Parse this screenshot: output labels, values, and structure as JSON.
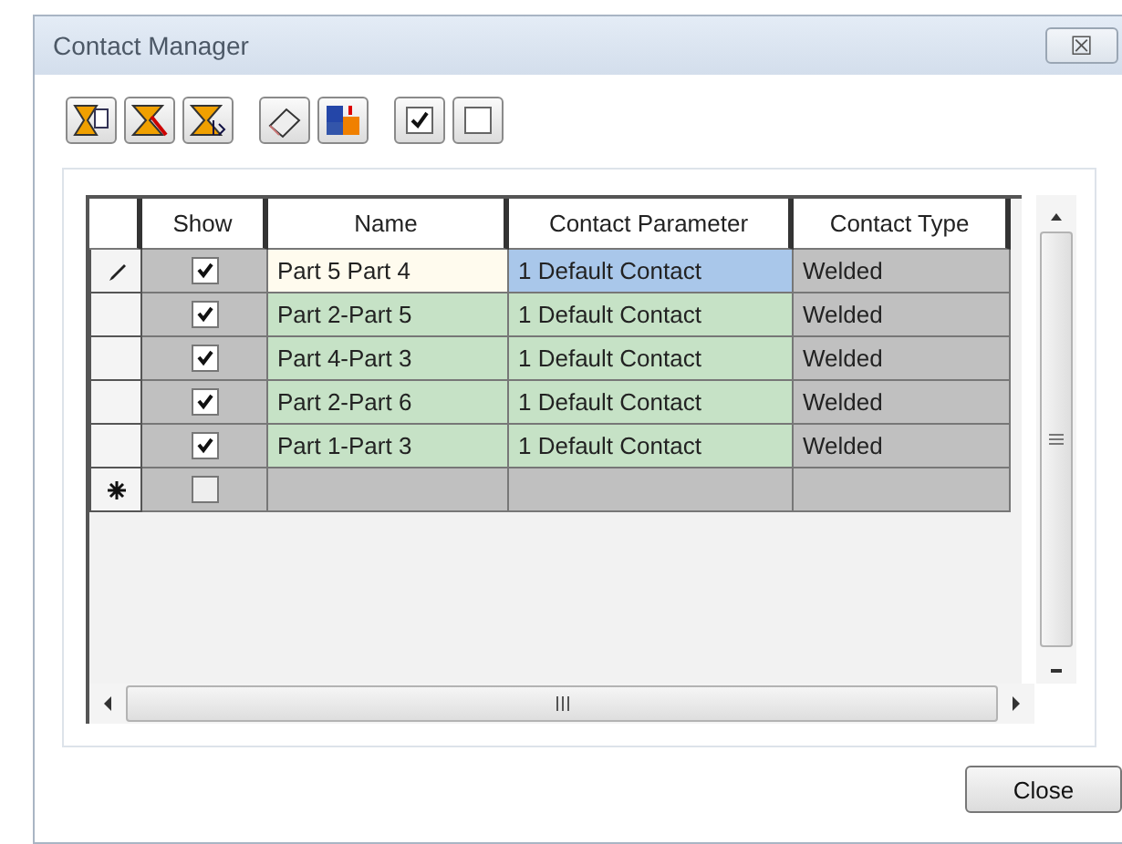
{
  "window": {
    "title": "Contact Manager",
    "close_glyph": "☒"
  },
  "table": {
    "columns": [
      "Show",
      "Name",
      "Contact Parameter",
      "Contact Type"
    ],
    "rows": [
      {
        "kind": "edit",
        "show": true,
        "selected": true,
        "name": "Part 5 Part 4",
        "parameter": "1 Default Contact",
        "type": "Welded"
      },
      {
        "kind": "plain",
        "show": true,
        "selected": false,
        "name": "Part 2-Part 5",
        "parameter": "1 Default Contact",
        "type": "Welded"
      },
      {
        "kind": "plain",
        "show": true,
        "selected": false,
        "name": "Part 4-Part 3",
        "parameter": "1 Default Contact",
        "type": "Welded"
      },
      {
        "kind": "plain",
        "show": true,
        "selected": false,
        "name": "Part 2-Part 6",
        "parameter": "1 Default Contact",
        "type": "Welded"
      },
      {
        "kind": "plain",
        "show": true,
        "selected": false,
        "name": "Part 1-Part 3",
        "parameter": "1 Default Contact",
        "type": "Welded"
      },
      {
        "kind": "new",
        "show": false,
        "selected": false
      }
    ]
  },
  "buttons": [
    "Close"
  ]
}
